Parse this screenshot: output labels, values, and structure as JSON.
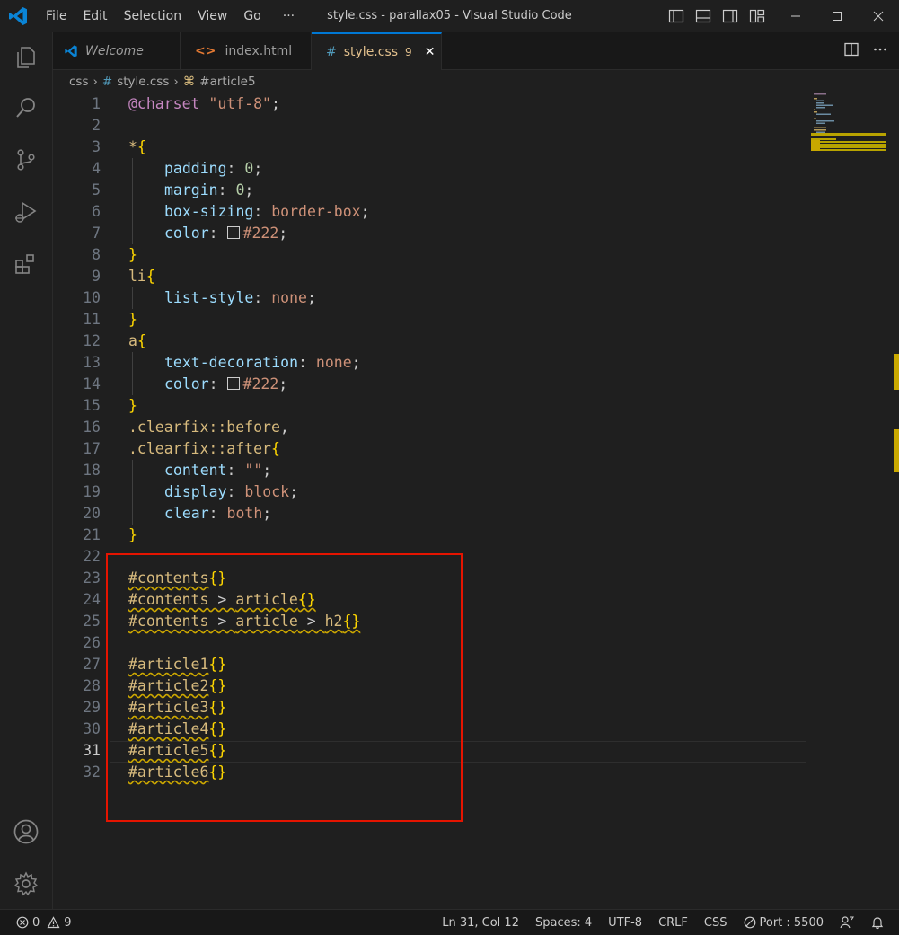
{
  "window": {
    "title": "style.css - parallax05 - Visual Studio Code",
    "menu": [
      "File",
      "Edit",
      "Selection",
      "View",
      "Go",
      "···"
    ]
  },
  "tabs": [
    {
      "label": "Welcome",
      "icon": "vscode-icon"
    },
    {
      "label": "index.html",
      "icon": "html-icon"
    },
    {
      "label": "style.css",
      "icon": "css-hash-icon",
      "badge": "9",
      "close": "✕"
    }
  ],
  "breadcrumb": {
    "folder": "css",
    "file_icon": "#",
    "file": "style.css",
    "symbol": "#article5"
  },
  "editor": {
    "active_line": 31,
    "line_numbers": [
      "1",
      "2",
      "3",
      "4",
      "5",
      "6",
      "7",
      "8",
      "9",
      "10",
      "11",
      "12",
      "13",
      "14",
      "15",
      "16",
      "17",
      "18",
      "19",
      "20",
      "21",
      "22",
      "23",
      "24",
      "25",
      "26",
      "27",
      "28",
      "29",
      "30",
      "31",
      "32"
    ],
    "code": {
      "l1": {
        "kw": "@charset",
        "str": "\"utf-8\"",
        "end": ";"
      },
      "l3": {
        "sel": "*",
        "open": "{"
      },
      "l4": {
        "prop": "padding",
        "sep": ": ",
        "val": "0",
        "end": ";"
      },
      "l5": {
        "prop": "margin",
        "sep": ": ",
        "val": "0",
        "end": ";"
      },
      "l6": {
        "prop": "box-sizing",
        "sep": ": ",
        "val": "border-box",
        "end": ";"
      },
      "l7": {
        "prop": "color",
        "sep": ": ",
        "val": "#222",
        "end": ";"
      },
      "l8": {
        "close": "}"
      },
      "l9": {
        "sel": "li",
        "open": "{"
      },
      "l10": {
        "prop": "list-style",
        "sep": ": ",
        "val": "none",
        "end": ";"
      },
      "l11": {
        "close": "}"
      },
      "l12": {
        "sel": "a",
        "open": "{"
      },
      "l13": {
        "prop": "text-decoration",
        "sep": ": ",
        "val": "none",
        "end": ";"
      },
      "l14": {
        "prop": "color",
        "sep": ": ",
        "val": "#222",
        "end": ";"
      },
      "l15": {
        "close": "}"
      },
      "l16": {
        "sel": ".clearfix::before",
        "end": ","
      },
      "l17": {
        "sel": ".clearfix::after",
        "open": "{"
      },
      "l18": {
        "prop": "content",
        "sep": ": ",
        "val": "\"\"",
        "end": ";"
      },
      "l19": {
        "prop": "display",
        "sep": ": ",
        "val": "block",
        "end": ";"
      },
      "l20": {
        "prop": "clear",
        "sep": ": ",
        "val": "both",
        "end": ";"
      },
      "l21": {
        "close": "}"
      },
      "l23": {
        "sel": "#contents",
        "braces": "{}"
      },
      "l24": {
        "sel_a": "#contents",
        "comb": " > ",
        "sel_b": "article",
        "braces": "{}"
      },
      "l25": {
        "sel_a": "#contents",
        "comb1": " > ",
        "sel_b": "article",
        "comb2": " > ",
        "sel_c": "h2",
        "braces": "{}"
      },
      "l27": {
        "sel": "#article1",
        "braces": "{}"
      },
      "l28": {
        "sel": "#article2",
        "braces": "{}"
      },
      "l29": {
        "sel": "#article3",
        "braces": "{}"
      },
      "l30": {
        "sel": "#article4",
        "braces": "{}"
      },
      "l31": {
        "sel": "#article5",
        "braces": "{}"
      },
      "l32": {
        "sel": "#article6",
        "braces": "{}"
      }
    }
  },
  "statusbar": {
    "errors": "0",
    "warnings": "9",
    "position": "Ln 31, Col 12",
    "spaces": "Spaces: 4",
    "encoding": "UTF-8",
    "eol": "CRLF",
    "language": "CSS",
    "port": "Port : 5500"
  },
  "colors": {
    "accent": "#0078d4",
    "highlight_box": "#e51400",
    "warning": "#cca700",
    "modified_tab": "#e2c08d"
  }
}
